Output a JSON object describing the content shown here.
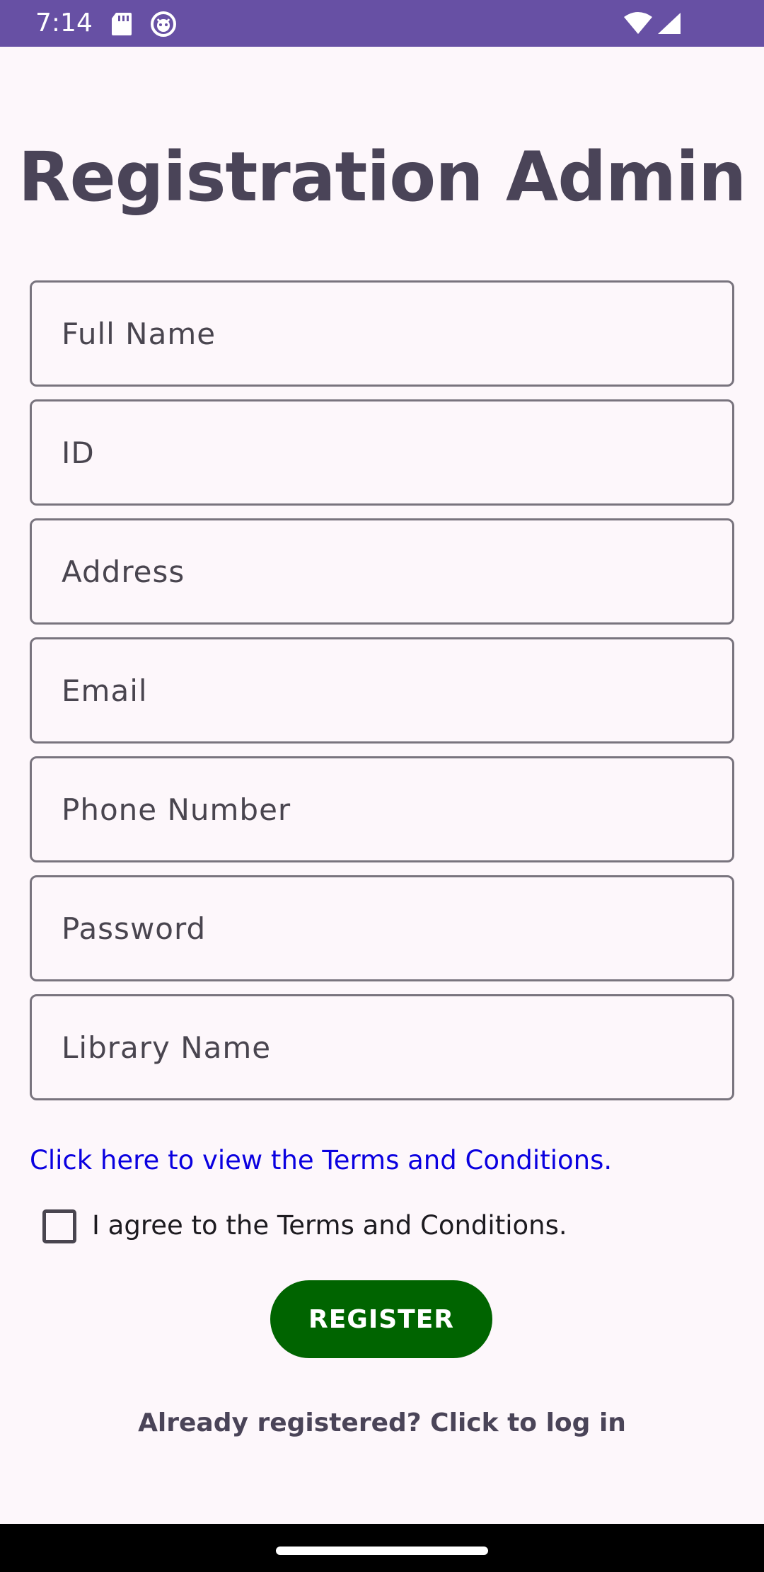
{
  "status_bar": {
    "time": "7:14",
    "icons": [
      "sd-card-icon",
      "robot-face-icon",
      "wifi-icon",
      "signal-icon"
    ],
    "background": "#6750a4"
  },
  "page": {
    "title": "Registration Admin"
  },
  "form": {
    "fields": [
      {
        "name": "full-name-field",
        "placeholder": "Full Name",
        "value": ""
      },
      {
        "name": "id-field",
        "placeholder": "ID",
        "value": ""
      },
      {
        "name": "address-field",
        "placeholder": "Address",
        "value": ""
      },
      {
        "name": "email-field",
        "placeholder": "Email",
        "value": ""
      },
      {
        "name": "phone-number-field",
        "placeholder": "Phone Number",
        "value": ""
      },
      {
        "name": "password-field",
        "placeholder": "Password",
        "value": ""
      },
      {
        "name": "library-name-field",
        "placeholder": "Library Name",
        "value": ""
      }
    ],
    "terms_link": "Click here to view the Terms and Conditions.",
    "terms_checkbox": {
      "label": "I agree to the Terms and Conditions.",
      "checked": false
    },
    "register_label": "REGISTER",
    "login_link": "Already registered? Click to log in"
  },
  "colors": {
    "accent": "#6750a4",
    "register_button": "#006400",
    "link": "#0a00e0",
    "title": "#4a4458"
  }
}
